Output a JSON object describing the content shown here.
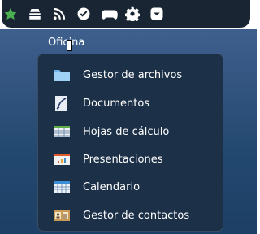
{
  "top_panel": {
    "icons": [
      "star-icon",
      "inbox-icon",
      "rss-feed-icon",
      "check-circle-icon",
      "gamepad-icon",
      "gear-icon",
      "chevron-down-box-icon"
    ]
  },
  "menu": {
    "title": "Oficina",
    "items": [
      {
        "label": "Gestor de archivos",
        "icon": "folder-icon"
      },
      {
        "label": "Documentos",
        "icon": "document-icon"
      },
      {
        "label": "Hojas de cálculo",
        "icon": "spreadsheet-icon"
      },
      {
        "label": "Presentaciones",
        "icon": "presentation-icon"
      },
      {
        "label": "Calendario",
        "icon": "calendar-icon"
      },
      {
        "label": "Gestor de contactos",
        "icon": "contacts-icon"
      }
    ]
  },
  "colors": {
    "panel": "#1a2533",
    "menu_bg": "#1c3048",
    "desktop": "#2a4b76",
    "star": "#4caf50"
  }
}
